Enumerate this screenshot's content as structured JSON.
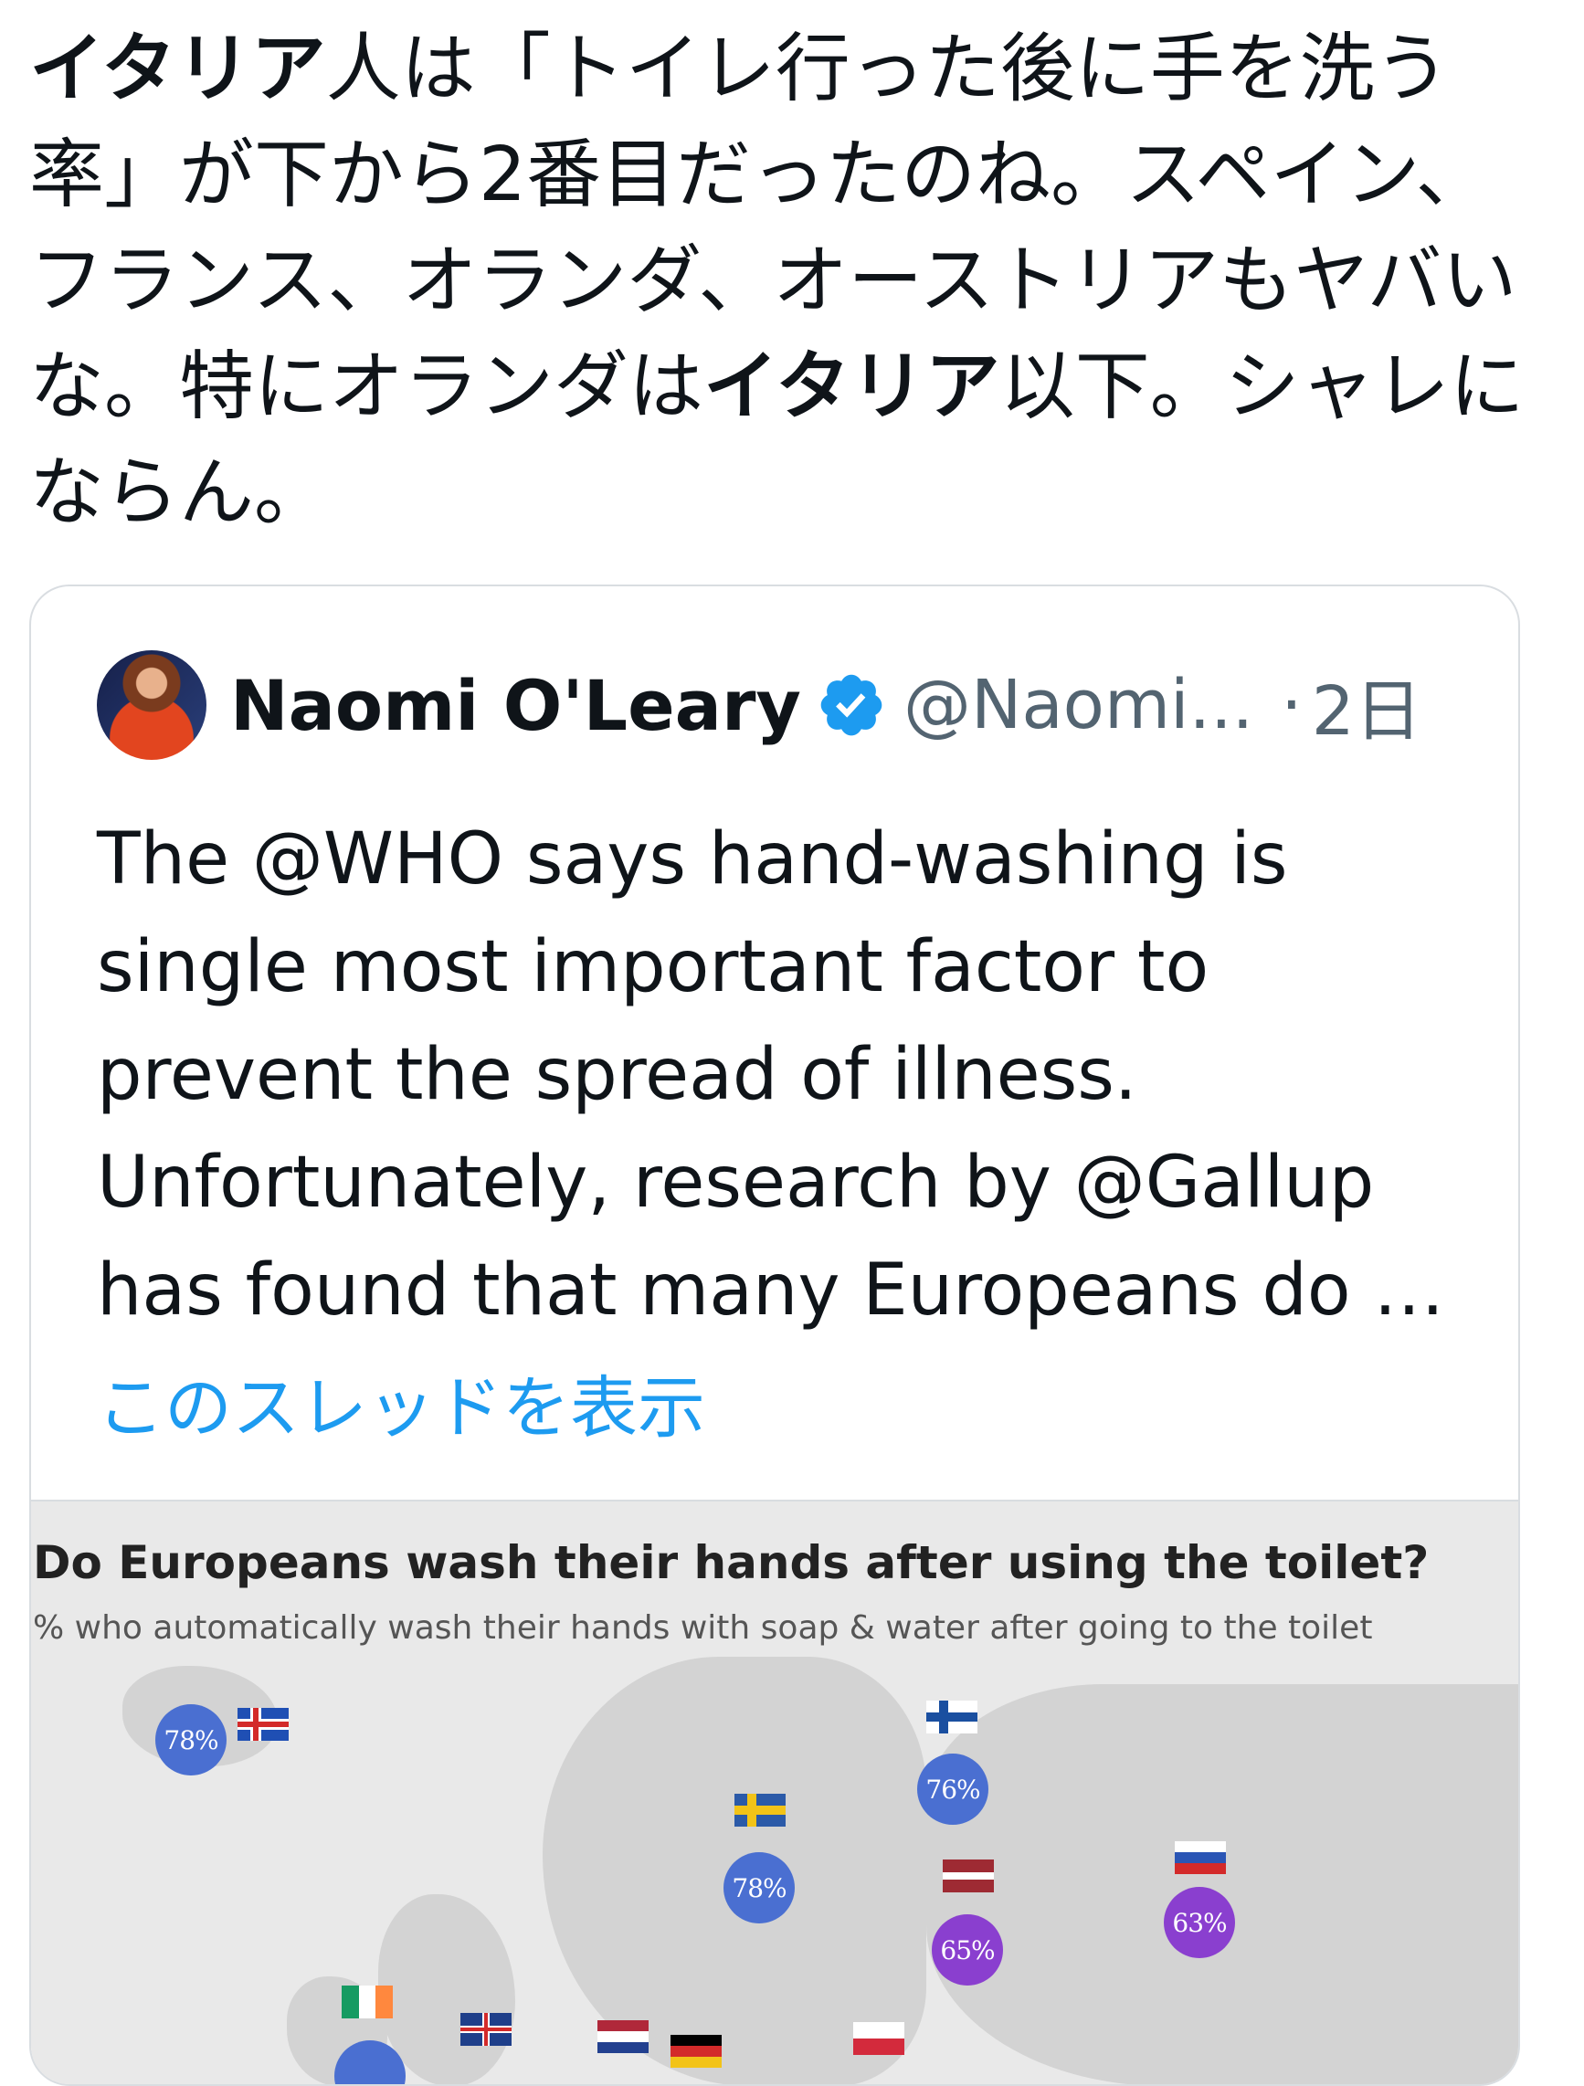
{
  "tweet": {
    "text_segments": [
      {
        "text": "イタリア",
        "bold": true
      },
      {
        "text": "人は「トイレ行った後に手を洗う率」が下から2番目だったのね。スペイン、フランス、オランダ、オーストリアもヤバいな。特にオランダは",
        "bold": false
      },
      {
        "text": "イタリア",
        "bold": true
      },
      {
        "text": "以下。シャレにならん。",
        "bold": false
      }
    ]
  },
  "quote": {
    "name": "Naomi O'Leary",
    "handle": "@Naomi...",
    "separator": "·",
    "time": "2日",
    "body": "The @WHO says hand-washing is single most important factor to prevent the spread of illness. Unfortunately, research by @Gallup has found that many Europeans do …",
    "show_thread": "このスレッドを表示",
    "verified_color": "#1d9bf0"
  },
  "map": {
    "title": "Do Europeans wash their hands after using the toilet?",
    "subtitle": "% who automatically wash their hands with soap & water after going to the toilet",
    "countries": [
      {
        "id": "iceland",
        "value": "78%",
        "color": "#4a6fd1"
      },
      {
        "id": "finland",
        "value": "76%",
        "color": "#4a6fd1"
      },
      {
        "id": "sweden",
        "value": "78%",
        "color": "#4a6fd1"
      },
      {
        "id": "latvia",
        "value": "65%",
        "color": "#8a3fcf"
      },
      {
        "id": "russia",
        "value": "63%",
        "color": "#8a3fcf"
      },
      {
        "id": "ireland",
        "value": "",
        "color": "#4a6fd1"
      }
    ]
  }
}
